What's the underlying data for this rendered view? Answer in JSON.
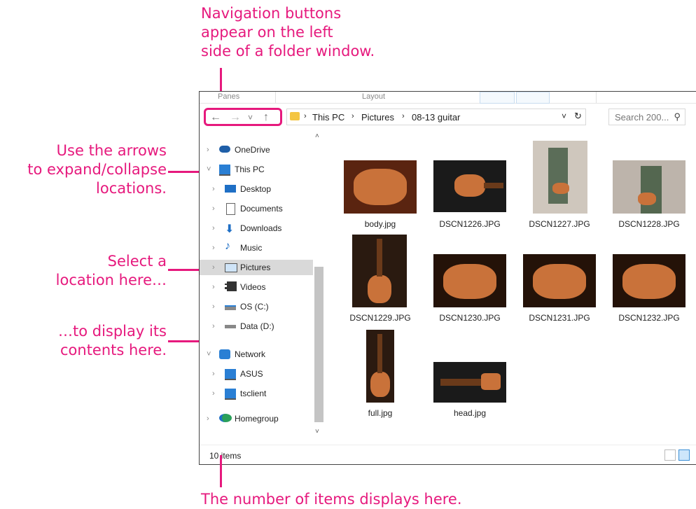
{
  "callouts": {
    "nav_buttons": [
      "Navigation buttons",
      "appear on the left",
      "side of a folder window."
    ],
    "arrows": [
      "Use the arrows",
      "to expand/collapse",
      "locations."
    ],
    "select": [
      "Select a",
      "location here…"
    ],
    "display": [
      "…to display its",
      "contents here."
    ],
    "count": "The number of items displays here."
  },
  "ribbon": {
    "panes": "Panes",
    "layout": "Layout"
  },
  "address": {
    "path": [
      "This PC",
      "Pictures",
      "08-13 guitar"
    ],
    "search_placeholder": "Search 200...",
    "back_icon": "←",
    "forward_icon": "→",
    "recent_icon": "˅",
    "up_icon": "↑"
  },
  "nav_pane": {
    "items": [
      {
        "label": "OneDrive",
        "icon": "cloud-icon"
      },
      {
        "label": "This PC",
        "icon": "computer-icon"
      },
      {
        "label": "Desktop",
        "icon": "desktop-icon"
      },
      {
        "label": "Documents",
        "icon": "document-icon"
      },
      {
        "label": "Downloads",
        "icon": "download-icon"
      },
      {
        "label": "Music",
        "icon": "music-icon"
      },
      {
        "label": "Pictures",
        "icon": "pictures-icon"
      },
      {
        "label": "Videos",
        "icon": "video-icon"
      },
      {
        "label": "OS (C:)",
        "icon": "drive-icon"
      },
      {
        "label": "Data (D:)",
        "icon": "drive-icon"
      },
      {
        "label": "Network",
        "icon": "network-icon"
      },
      {
        "label": "ASUS",
        "icon": "computer-icon"
      },
      {
        "label": "tsclient",
        "icon": "computer-icon"
      },
      {
        "label": "Homegroup",
        "icon": "homegroup-icon"
      }
    ]
  },
  "files": [
    "body.jpg",
    "DSCN1226.JPG",
    "DSCN1227.JPG",
    "DSCN1228.JPG",
    "DSCN1229.JPG",
    "DSCN1230.JPG",
    "DSCN1231.JPG",
    "DSCN1232.JPG",
    "full.jpg",
    "head.jpg"
  ],
  "status": {
    "count": "10 items"
  },
  "colors": {
    "accent": "#e6197d",
    "selection": "#d9d9d9"
  }
}
